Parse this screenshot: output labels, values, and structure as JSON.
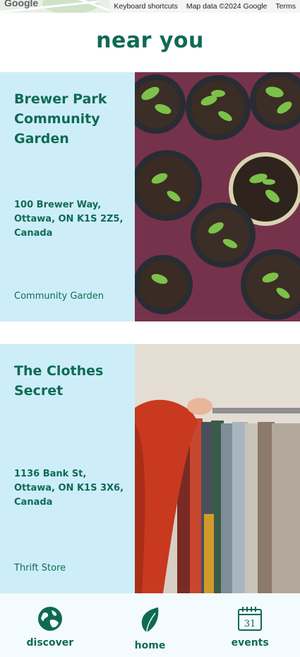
{
  "map": {
    "logo": "Google",
    "attribution": [
      "Keyboard shortcuts",
      "Map data ©2024 Google",
      "Terms"
    ]
  },
  "section_title": "near you",
  "places": [
    {
      "name": "Brewer Park Community Garden",
      "address": "100 Brewer Way, Ottawa, ON K1S 2Z5, Canada",
      "category": "Community Garden",
      "image": "seedling-pots-photo"
    },
    {
      "name": "The Clothes Secret",
      "address": "1136 Bank St, Ottawa, ON K1S 3X6, Canada",
      "category": "Thrift Store",
      "image": "clothing-rack-photo"
    }
  ],
  "nav": {
    "items": [
      {
        "label": "discover",
        "icon": "globe-icon"
      },
      {
        "label": "home",
        "icon": "leaf-icon"
      },
      {
        "label": "events",
        "icon": "calendar-icon"
      }
    ],
    "calendar_day": "31"
  },
  "colors": {
    "accent": "#0f6a55",
    "card_bg": "#cdeef8",
    "nav_bg": "#f4fbfe"
  }
}
